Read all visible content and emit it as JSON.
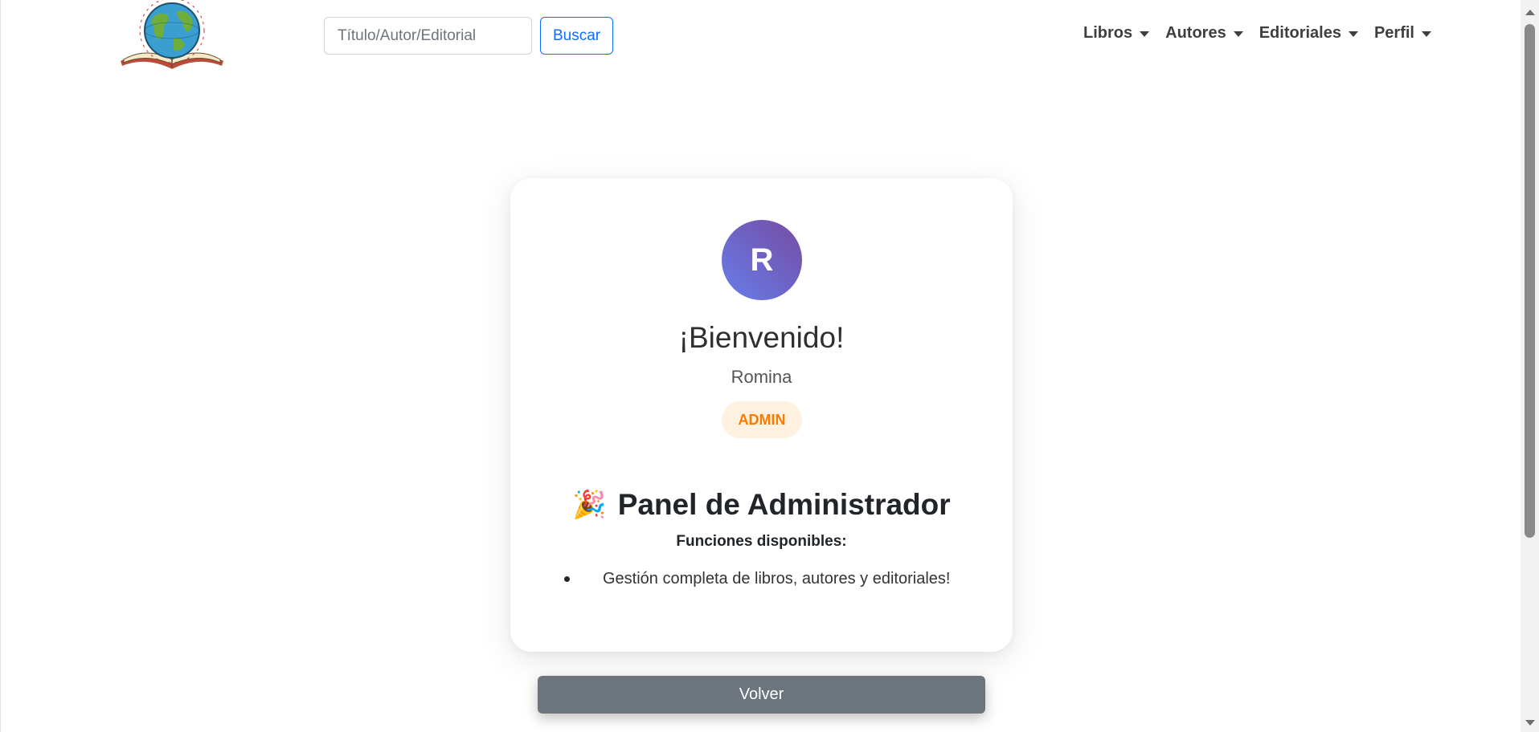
{
  "navbar": {
    "search": {
      "placeholder": "Título/Autor/Editorial",
      "button_label": "Buscar"
    },
    "menu": [
      {
        "label": "Libros"
      },
      {
        "label": "Autores"
      },
      {
        "label": "Editoriales"
      },
      {
        "label": "Perfil"
      }
    ]
  },
  "profile": {
    "avatar_initial": "R",
    "welcome": "¡Bienvenido!",
    "username": "Romina",
    "role": "ADMIN"
  },
  "panel": {
    "icon": "🎉",
    "title": "Panel de Administrador",
    "functions_heading": "Funciones disponibles:",
    "functions": [
      "Gestión completa de libros, autores y editoriales!"
    ]
  },
  "back_button": "Volver",
  "colors": {
    "primary": "#0d6efd",
    "secondary": "#6c757d",
    "avatar_gradient_start": "#667eea",
    "avatar_gradient_end": "#764ba2",
    "badge_bg": "#fff1df",
    "badge_text": "#f57c00"
  }
}
